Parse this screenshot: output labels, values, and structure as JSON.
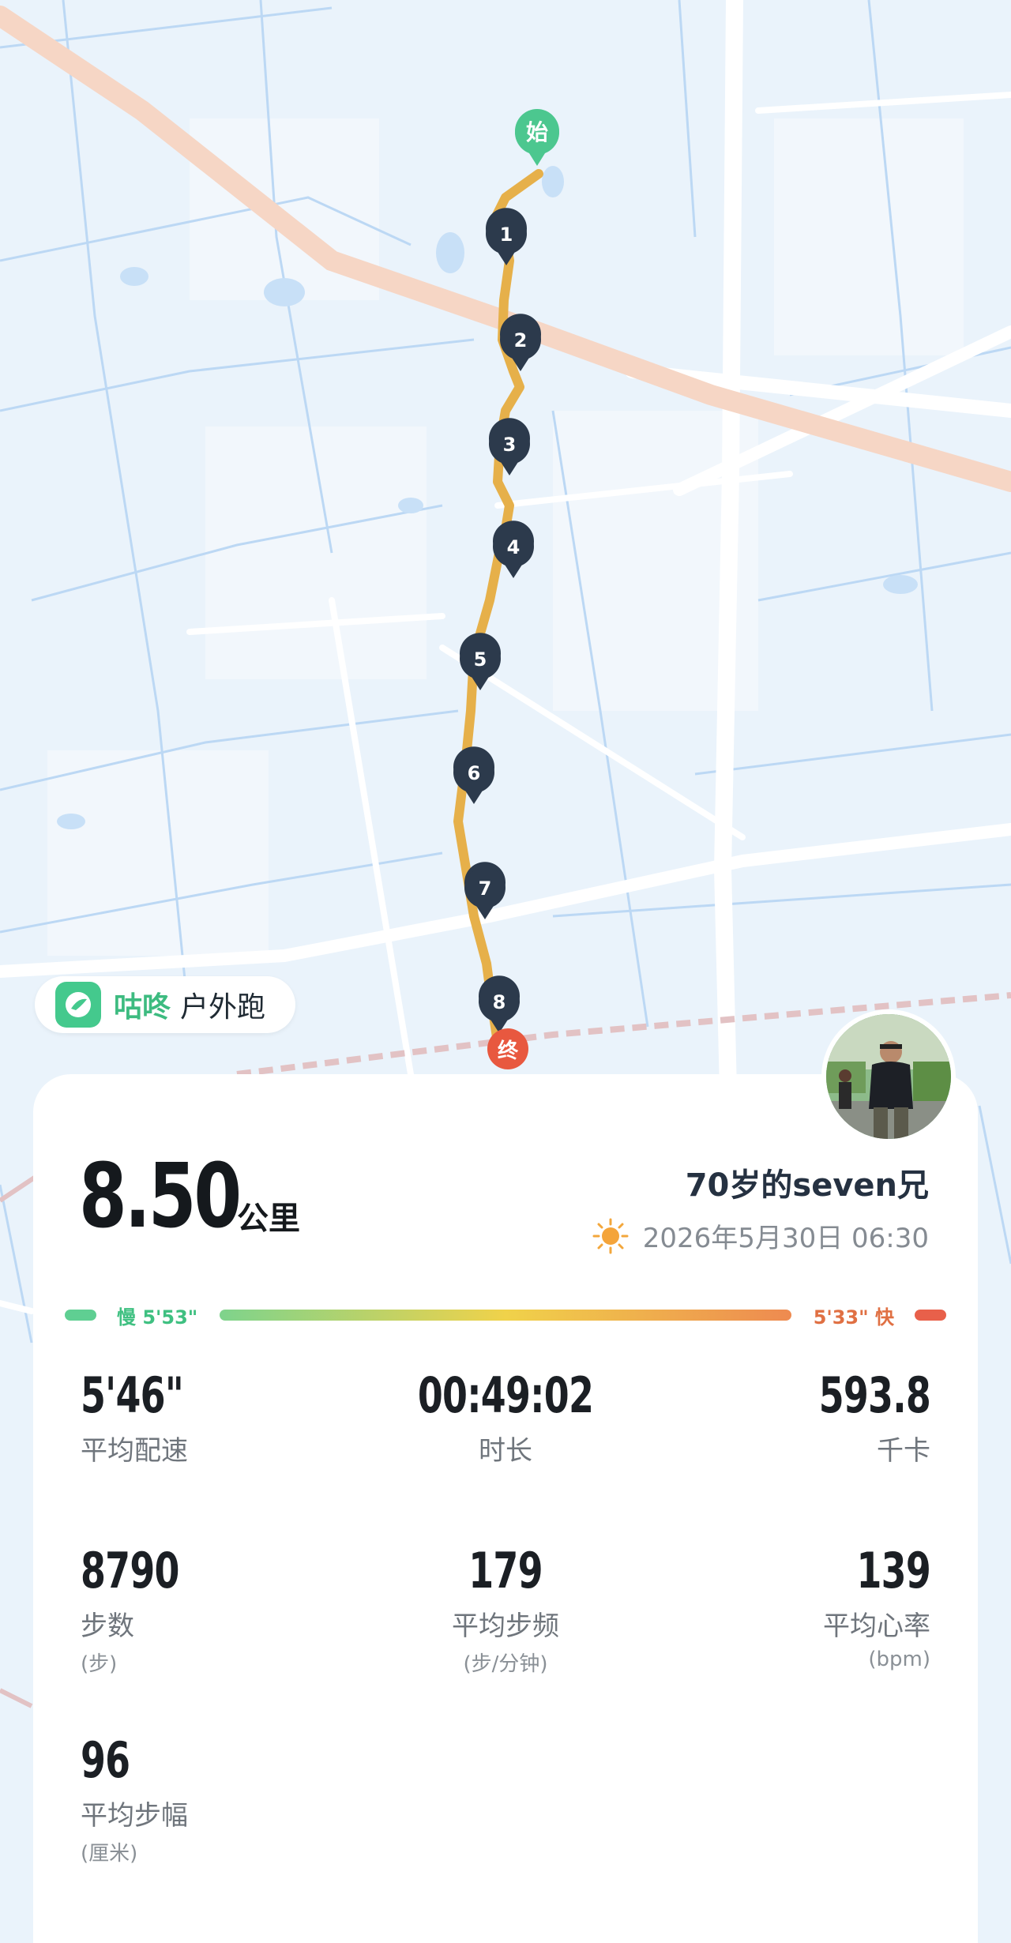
{
  "map": {
    "start_label": "始",
    "end_label": "终",
    "km_markers": [
      "1",
      "2",
      "3",
      "4",
      "5",
      "6",
      "7",
      "8"
    ],
    "route_color": "#e6b04a",
    "marker_color": "#2c3a4c",
    "start_color": "#4cc78f",
    "end_color": "#e8583f"
  },
  "brand": {
    "name": "咕咚",
    "mode": "户外跑"
  },
  "summary": {
    "distance": "8.50",
    "distance_unit": "公里",
    "user_name": "70岁的seven兄",
    "weather_icon": "sun-icon",
    "datetime": "2026年5月30日 06:30"
  },
  "pace_scale": {
    "slow_label": "慢 5'53\"",
    "fast_label": "5'33\" 快",
    "slow_color": "#5fcf92",
    "fast_color": "#e8604a"
  },
  "stats": {
    "avg_pace": {
      "value": "5'46\"",
      "label": "平均配速"
    },
    "duration": {
      "value": "00:49:02",
      "label": "时长"
    },
    "calories": {
      "value": "593.8",
      "label": "千卡"
    },
    "steps": {
      "value": "8790",
      "label": "步数",
      "unit": "(步)"
    },
    "cadence": {
      "value": "179",
      "label": "平均步频",
      "unit": "(步/分钟)"
    },
    "heart_rate": {
      "value": "139",
      "label": "平均心率",
      "unit": "(bpm)"
    },
    "stride": {
      "value": "96",
      "label": "平均步幅",
      "unit": "(厘米)"
    }
  }
}
